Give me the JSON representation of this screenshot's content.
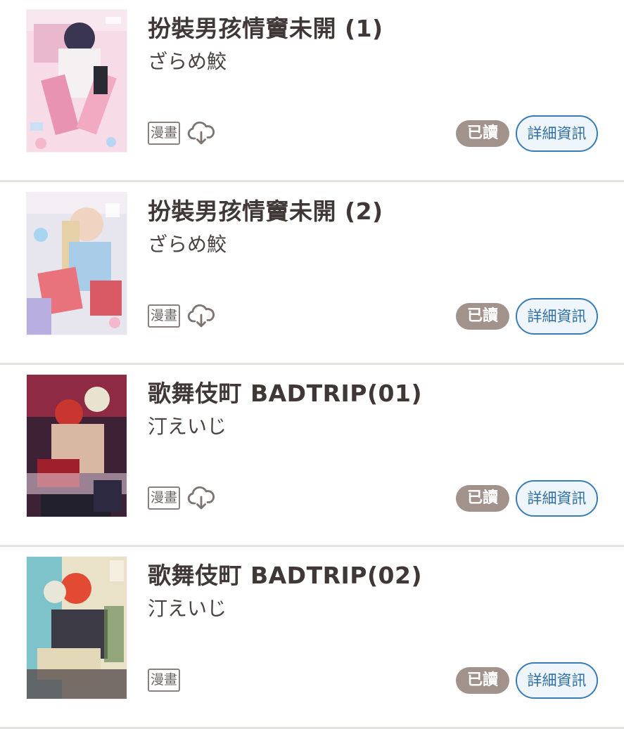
{
  "items": [
    {
      "title": "扮裝男孩情竇未開 (1)",
      "author": "ざらめ鮫",
      "type_tag": "漫畫",
      "has_download_icon": true,
      "read_status": "已讀",
      "detail_label": "詳細資訊",
      "cover_label": "扮裝男孩情竇未開"
    },
    {
      "title": "扮裝男孩情竇未開 (2)",
      "author": "ざらめ鮫",
      "type_tag": "漫畫",
      "has_download_icon": true,
      "read_status": "已讀",
      "detail_label": "詳細資訊",
      "cover_label": "扮裝男孩情竇未開"
    },
    {
      "title": "歌舞伎町 BADTRIP(01)",
      "author": "汀えいじ",
      "type_tag": "漫畫",
      "has_download_icon": true,
      "read_status": "已讀",
      "detail_label": "詳細資訊",
      "cover_label": "歌舞伎町"
    },
    {
      "title": "歌舞伎町 BADTRIP(02)",
      "author": "汀えいじ",
      "type_tag": "漫畫",
      "has_download_icon": false,
      "read_status": "已讀",
      "detail_label": "詳細資訊",
      "cover_label": "歌舞伎町"
    }
  ],
  "colors": {
    "read_badge_bg": "#a1928c",
    "detail_border": "#3a7cb5",
    "detail_text": "#2f6fa6",
    "title_text": "#3f3836",
    "divider": "#e6e4e3"
  }
}
